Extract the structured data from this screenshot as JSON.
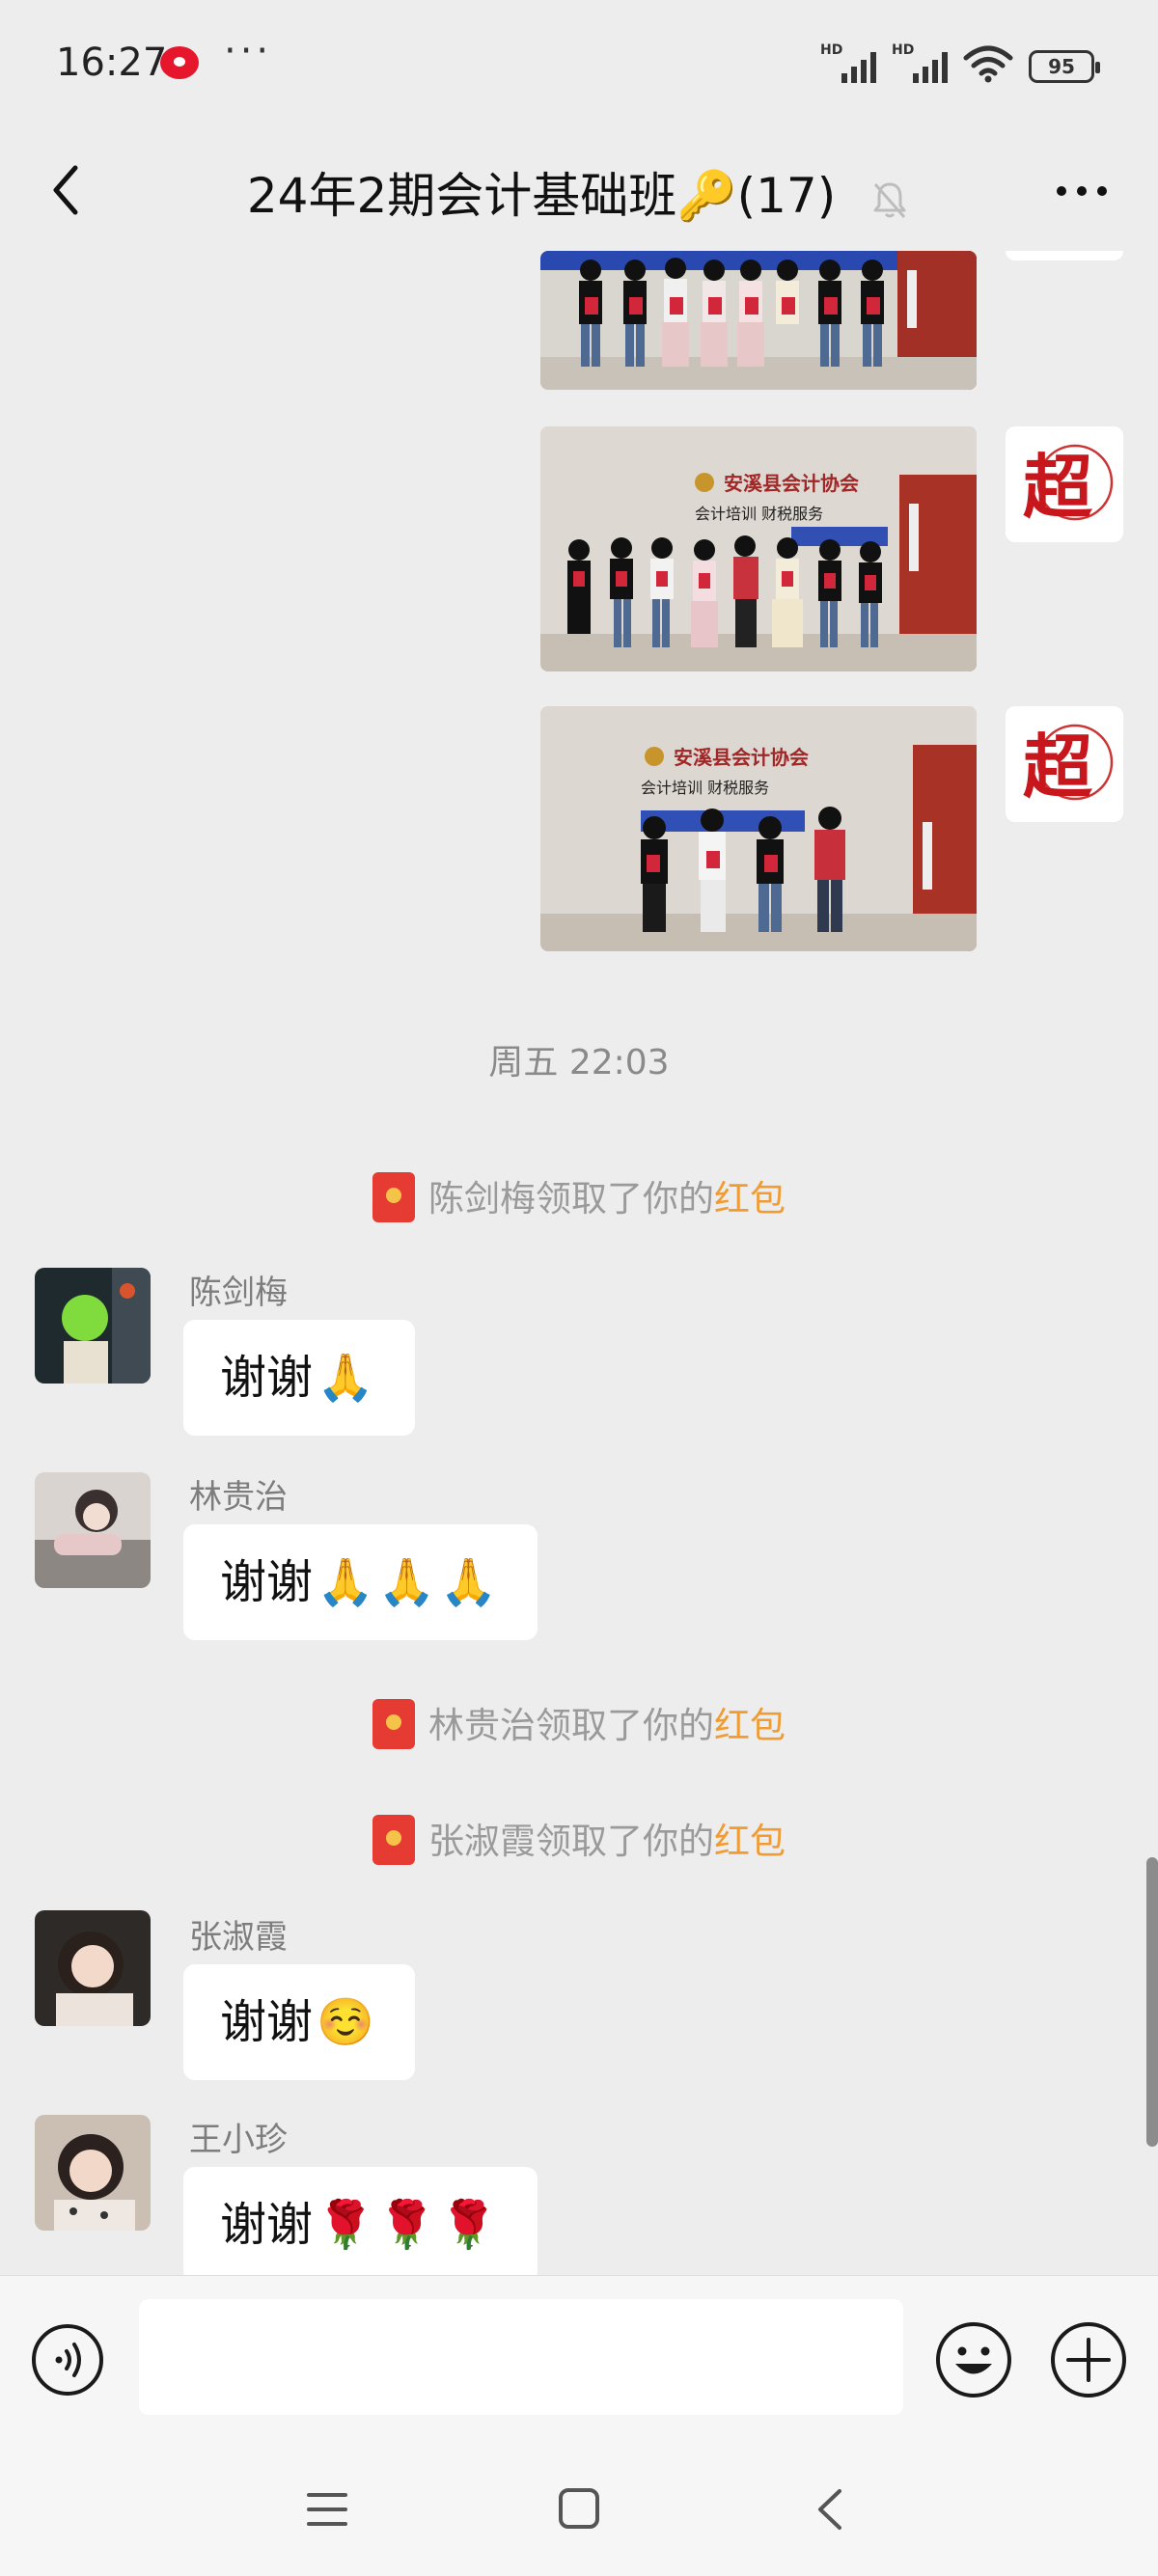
{
  "status_bar": {
    "time": "16:27",
    "more": "···",
    "signal_label": "HD",
    "signal2_label": "HD",
    "battery": "95",
    "icons": [
      "weibo-icon",
      "signal-icon",
      "signal-icon",
      "wifi-icon",
      "battery-icon"
    ]
  },
  "header": {
    "title": "24年2期会计基础班🔑(17)",
    "icons": [
      "back-icon",
      "mute-bell-icon",
      "more-icon"
    ]
  },
  "messages": {
    "time_label": "周五 22:03",
    "system": [
      {
        "name": "陈剑梅",
        "text": "领取了你的",
        "link": "红包"
      },
      {
        "name": "林贵治",
        "text": "领取了你的",
        "link": "红包"
      },
      {
        "name": "张淑霞",
        "text": "领取了你的",
        "link": "红包"
      }
    ],
    "chats": [
      {
        "name": "陈剑梅",
        "text": "谢谢",
        "emoji": "🙏"
      },
      {
        "name": "林贵治",
        "text": "谢谢",
        "emoji": "🙏🙏🙏"
      },
      {
        "name": "张淑霞",
        "text": "谢谢",
        "emoji": "☺️"
      },
      {
        "name": "王小珍",
        "text": "谢谢",
        "emoji": "🌹🌹🌹"
      }
    ],
    "photos": [
      {
        "banner": "",
        "subline": ""
      },
      {
        "banner": "安溪县会计协会",
        "subline": "会计培训  财税服务"
      },
      {
        "banner": "安溪县会计协会",
        "subline": "会计培训  财税服务"
      }
    ],
    "sender_logo_text": "超"
  },
  "input_bar": {
    "placeholder": "",
    "icons": [
      "voice-icon",
      "emoji-icon",
      "plus-icon"
    ]
  },
  "nav_bar": {
    "icons": [
      "menu-icon",
      "home-icon",
      "back-nav-icon"
    ]
  },
  "colors": {
    "background": "#ededed",
    "bubble": "#ffffff",
    "red_packet": "#e53b33",
    "red_packet_word": "#f19b33"
  }
}
